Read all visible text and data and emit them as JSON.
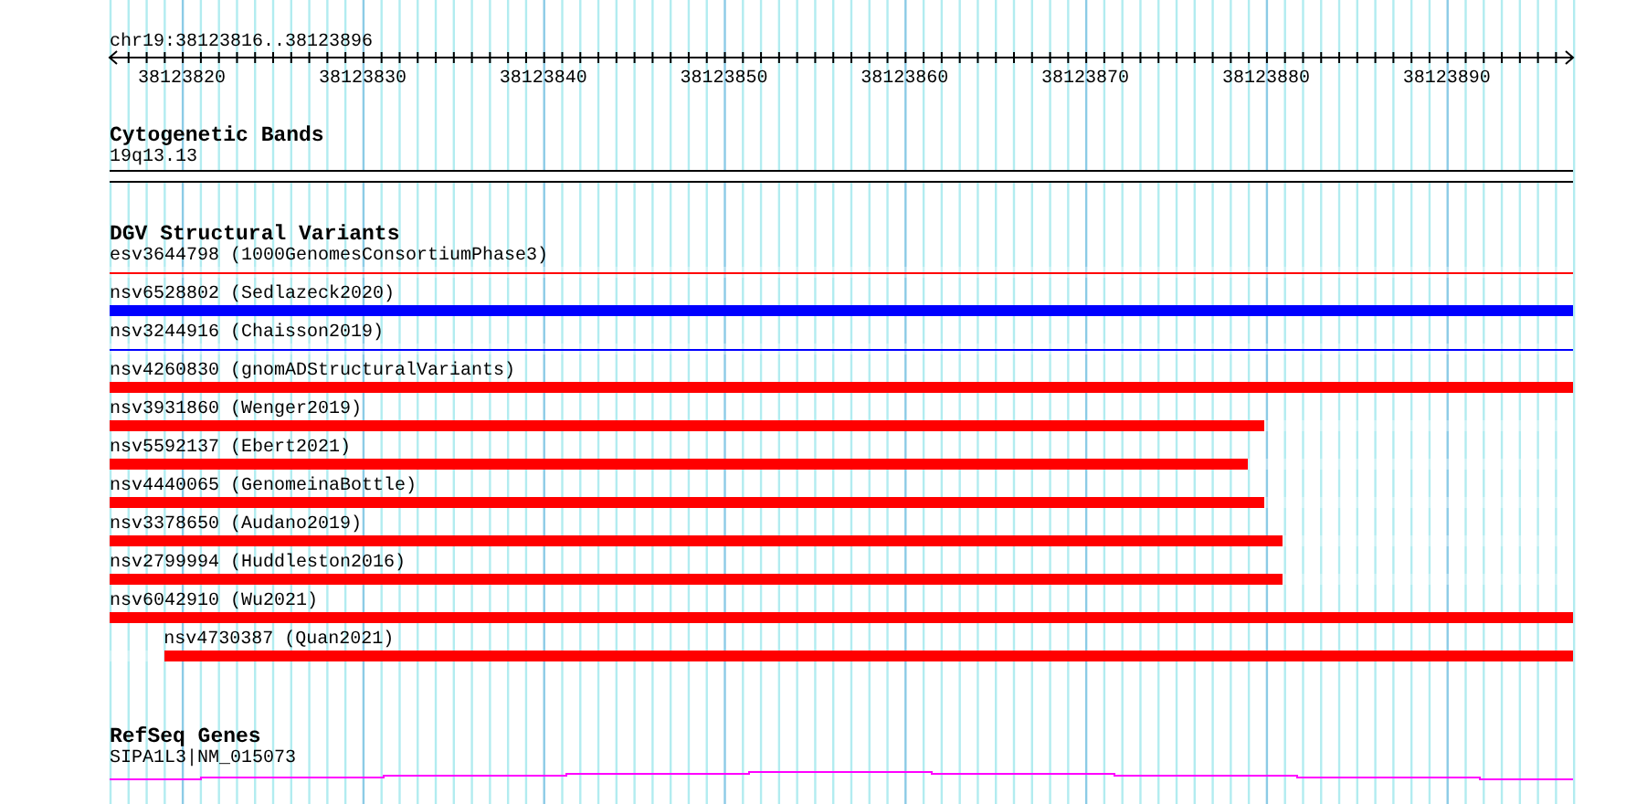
{
  "location": "chr19:38123816..38123896",
  "ruler": {
    "labels": [
      "38123820",
      "38123830",
      "38123840",
      "38123850",
      "38123860",
      "38123870",
      "38123880",
      "38123890"
    ]
  },
  "tracks": [
    {
      "kind": "cytoband",
      "title": "Cytogenetic Bands",
      "features": [
        {
          "label": "19q13.13"
        }
      ]
    },
    {
      "kind": "variants",
      "title": "DGV Structural Variants",
      "features": [
        {
          "label": "esv3644798 (1000GenomesConsortiumPhase3)",
          "kind": "line",
          "color": "#ff0000",
          "level": 1
        },
        {
          "label": "nsv6528802 (Sedlazeck2020)",
          "kind": "bar",
          "color": "#0000ff",
          "level": 1
        },
        {
          "label": "nsv3244916 (Chaisson2019)",
          "kind": "line",
          "color": "#0000ff",
          "level": 1
        },
        {
          "label": "nsv4260830 (gnomADStructuralVariants)",
          "kind": "bar",
          "color": "#ff0000",
          "level": 1
        },
        {
          "label": "nsv3931860 (Wenger2019)",
          "kind": "bar",
          "color": "#ff0000",
          "level": 0.789
        },
        {
          "label": "nsv5592137 (Ebert2021)",
          "kind": "bar",
          "color": "#ff0000",
          "level": 0.778
        },
        {
          "label": "nsv4440065 (GenomeinaBottle)",
          "kind": "bar",
          "color": "#ff0000",
          "level": 0.789
        },
        {
          "label": "nsv3378650 (Audano2019)",
          "kind": "bar",
          "color": "#ff0000",
          "level": 0.801
        },
        {
          "label": "nsv2799994 (Huddleston2016)",
          "kind": "bar",
          "color": "#ff0000",
          "level": 0.801
        },
        {
          "label": "nsv6042910 (Wu2021)",
          "kind": "bar",
          "color": "#ff0000",
          "level": 1
        },
        {
          "label": "nsv4730387 (Quan2021)",
          "kind": "inset",
          "color": "#ff0000",
          "level": 0.963
        }
      ]
    },
    {
      "kind": "genes",
      "title": "RefSeq Genes",
      "features": [
        {
          "label": "SIPA1L3|NM_015073"
        }
      ]
    }
  ]
}
